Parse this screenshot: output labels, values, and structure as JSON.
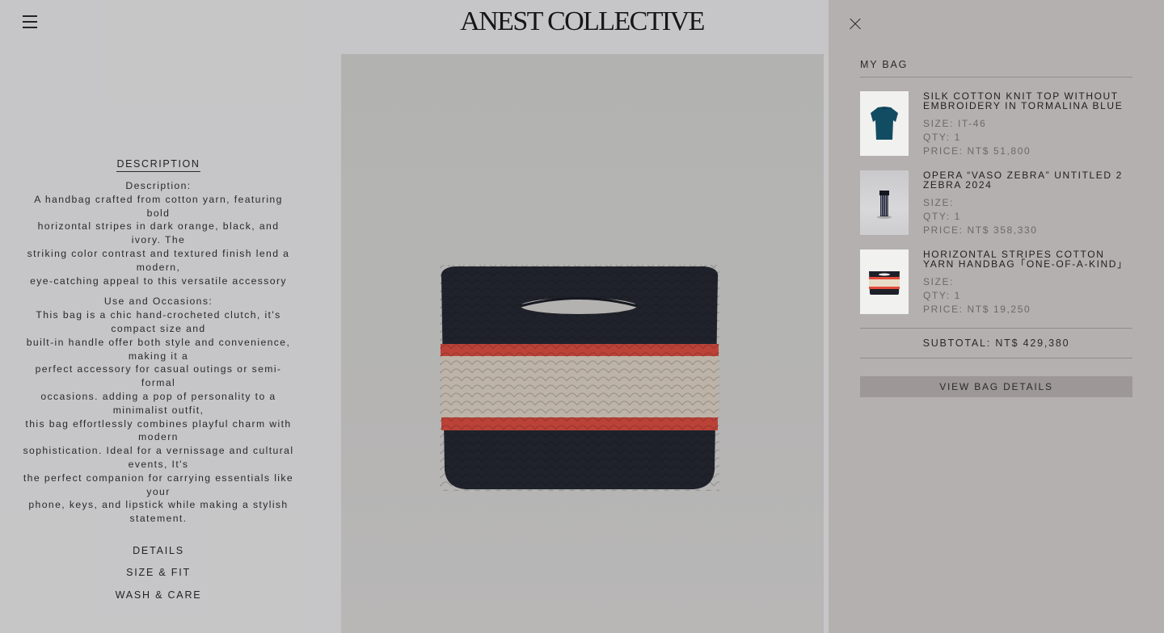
{
  "header": {
    "brand": "ANEST COLLECTIVE",
    "menu_icon": "hamburger-icon"
  },
  "description": {
    "tab_label": "DESCRIPTION",
    "paragraph_1": "Description:\nA handbag crafted from cotton yarn, featuring bold\nhorizontal stripes in dark orange, black, and ivory. The\nstriking color contrast and textured finish lend a modern,\neye-catching appeal to this versatile accessory",
    "paragraph_2": "Use and Occasions:\nThis bag is a chic hand-crocheted clutch, it's compact size and\nbuilt-in handle offer both style and convenience, making it a\nperfect accessory for casual outings or semi-formal\noccasions. adding a pop of personality to a minimalist outfit,\nthis bag effortlessly combines playful charm with modern\nsophistication. Ideal for a vernissage and cultural events, It's\nthe perfect companion for carrying essentials like your\nphone, keys, and lipstick while making a stylish statement.",
    "sections": [
      "DETAILS",
      "SIZE & FIT",
      "WASH & CARE"
    ]
  },
  "product_image": {
    "subject": "crocheted striped handbag",
    "colors": {
      "black": "#1d2028",
      "orange": "#e64a3a",
      "ivory": "#e7dcc8"
    }
  },
  "cart": {
    "close_icon": "close-icon",
    "title": "MY BAG",
    "items": [
      {
        "name": "SILK COTTON KNIT TOP WITHOUT EMBROIDERY IN TORMALINA BLUE",
        "size": "SIZE: IT-46",
        "qty": "QTY: 1",
        "price": "PRICE: NT$ 51,800"
      },
      {
        "name": "OPERA “VASO ZEBRA” UNTITLED 2 ZEBRA 2024",
        "size": "SIZE:",
        "qty": "QTY: 1",
        "price": "PRICE: NT$ 358,330"
      },
      {
        "name": "HORIZONTAL STRIPES COTTON YARN HANDBAG「ONE-OF-A-KIND」",
        "size": "SIZE:",
        "qty": "QTY: 1",
        "price": "PRICE: NT$ 19,250"
      }
    ],
    "subtotal": "SUBTOTAL:  NT$ 429,380",
    "view_button": "VIEW BAG DETAILS"
  }
}
